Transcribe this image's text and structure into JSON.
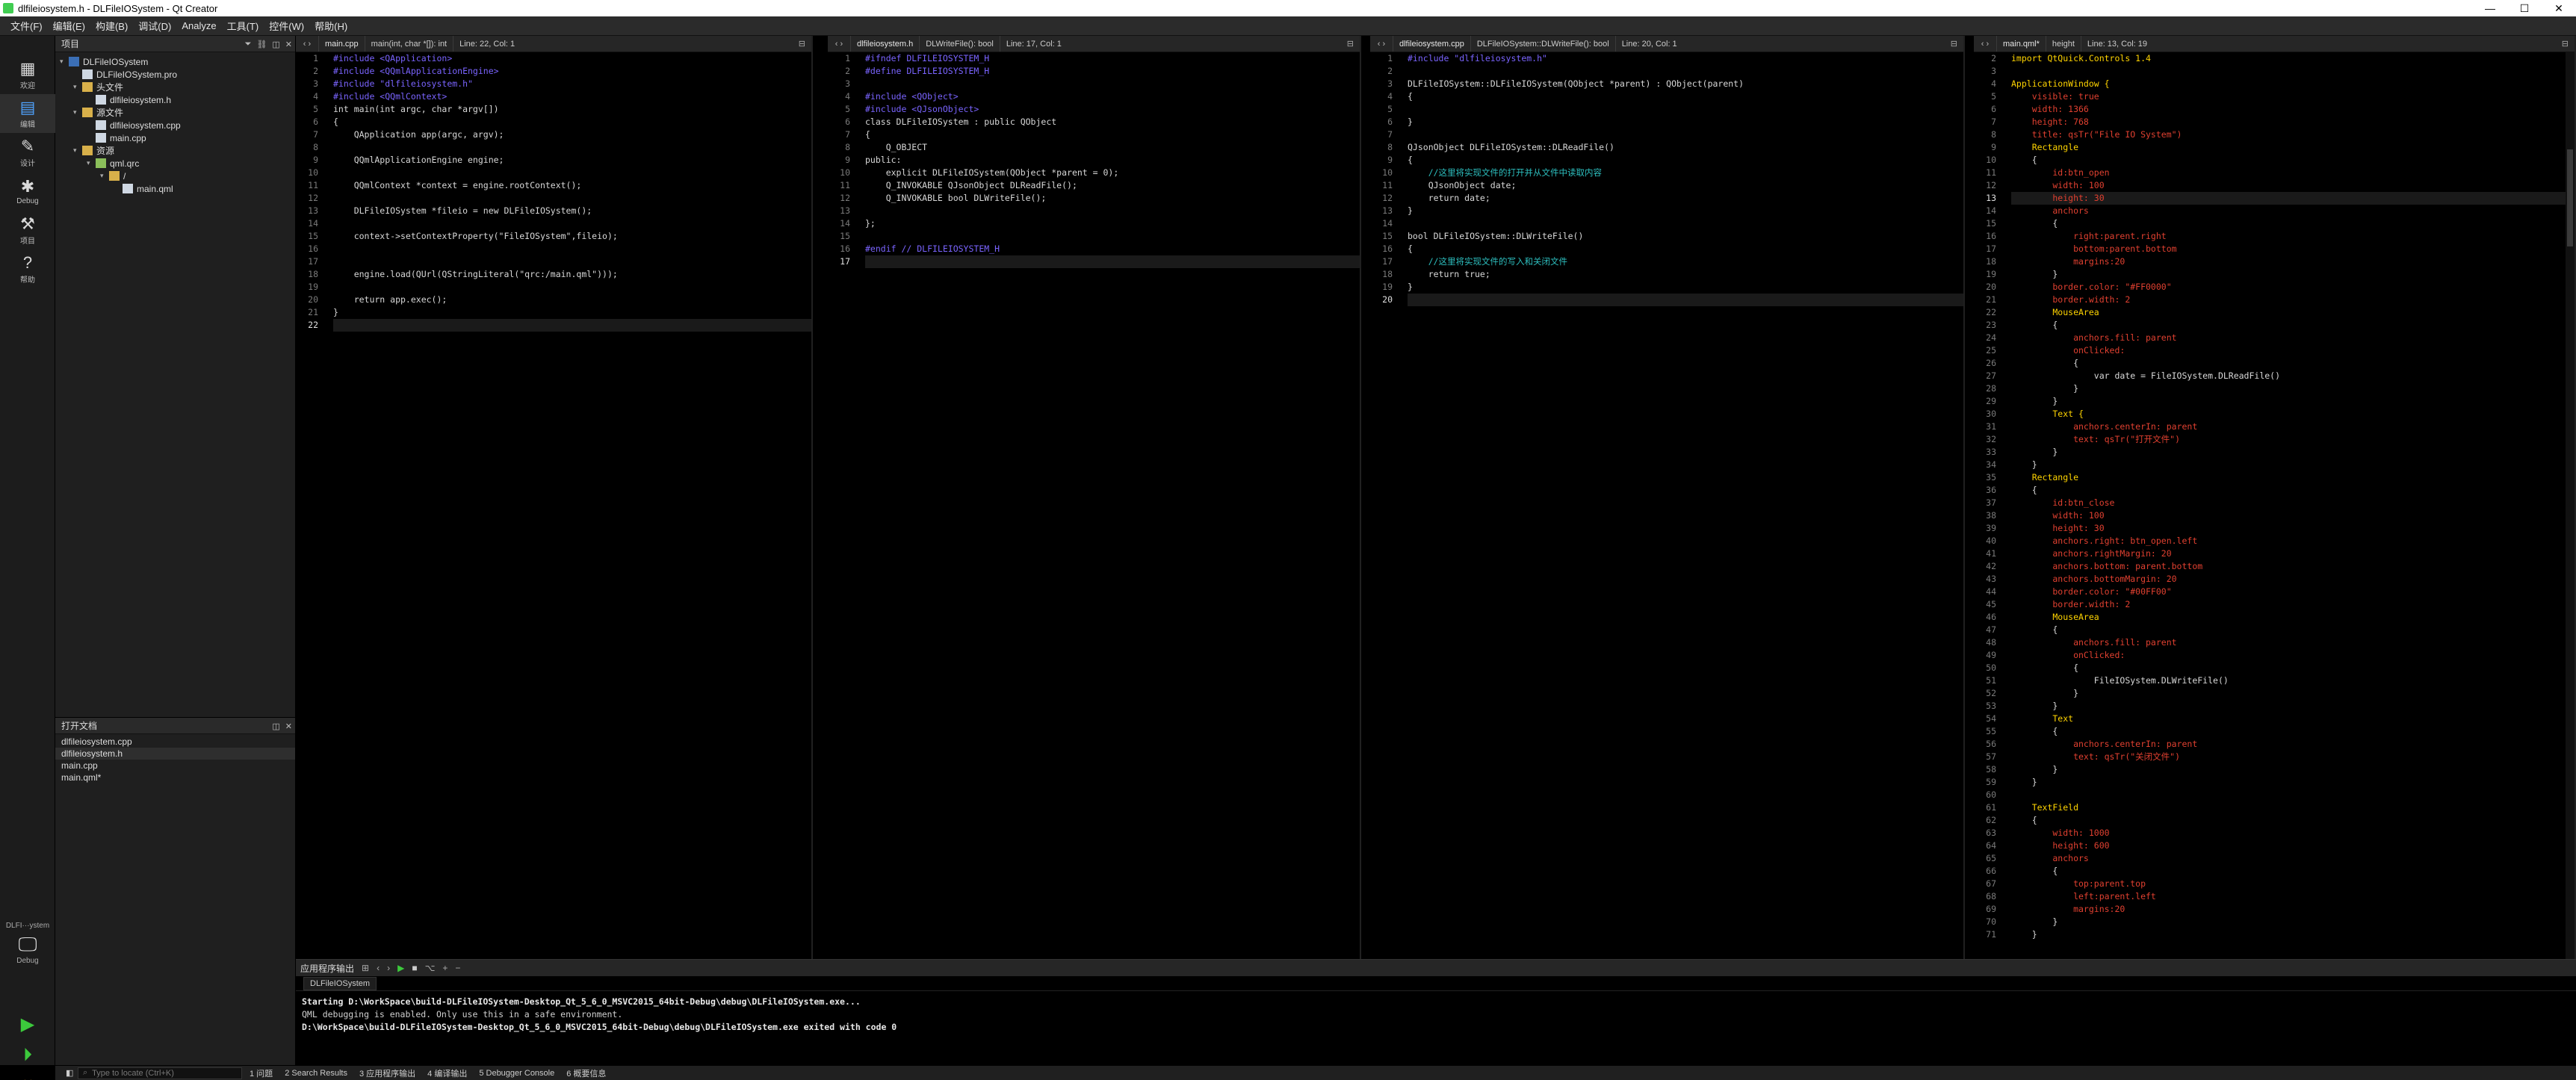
{
  "window": {
    "title": "dlfileiosystem.h - DLFileIOSystem - Qt Creator",
    "min": "—",
    "max": "☐",
    "close": "✕"
  },
  "menu": [
    "文件(F)",
    "编辑(E)",
    "构建(B)",
    "调试(D)",
    "Analyze",
    "工具(T)",
    "控件(W)",
    "帮助(H)"
  ],
  "modes": [
    {
      "label": "欢迎",
      "icon": "grid-icon"
    },
    {
      "label": "编辑",
      "icon": "edit-icon"
    },
    {
      "label": "设计",
      "icon": "pencil-icon"
    },
    {
      "label": "Debug",
      "icon": "bug-icon"
    },
    {
      "label": "项目",
      "icon": "wrench-icon"
    },
    {
      "label": "帮助",
      "icon": "help-icon"
    }
  ],
  "kit": {
    "name": "DLFI···ystem",
    "mode": "Debug"
  },
  "project_panel": {
    "title": "项目",
    "tree": [
      {
        "label": "DLFileIOSystem",
        "depth": 0,
        "icon": "proj",
        "arrow": "▾"
      },
      {
        "label": "DLFileIOSystem.pro",
        "depth": 1,
        "icon": "file",
        "arrow": ""
      },
      {
        "label": "头文件",
        "depth": 1,
        "icon": "folder",
        "arrow": "▾"
      },
      {
        "label": "dlfileiosystem.h",
        "depth": 2,
        "icon": "file",
        "arrow": ""
      },
      {
        "label": "源文件",
        "depth": 1,
        "icon": "folder",
        "arrow": "▾"
      },
      {
        "label": "dlfileiosystem.cpp",
        "depth": 2,
        "icon": "file",
        "arrow": ""
      },
      {
        "label": "main.cpp",
        "depth": 2,
        "icon": "file",
        "arrow": ""
      },
      {
        "label": "资源",
        "depth": 1,
        "icon": "folder",
        "arrow": "▾"
      },
      {
        "label": "qml.qrc",
        "depth": 2,
        "icon": "qrc",
        "arrow": "▾"
      },
      {
        "label": "/",
        "depth": 3,
        "icon": "folder",
        "arrow": "▾"
      },
      {
        "label": "main.qml",
        "depth": 4,
        "icon": "file",
        "arrow": ""
      }
    ]
  },
  "open_docs": {
    "title": "打开文档",
    "items": [
      "dlfileiosystem.cpp",
      "dlfileiosystem.h",
      "main.cpp",
      "main.qml*"
    ]
  },
  "editors": [
    {
      "file": "main.cpp",
      "symbol": "main(int, char *[]): int",
      "pos": "Line: 22, Col: 1",
      "current_line": 22,
      "lines": [
        [
          "pp",
          "#include <QApplication>"
        ],
        [
          "pp",
          "#include <QQmlApplicationEngine>"
        ],
        [
          "pp",
          "#include \"dlfileiosystem.h\""
        ],
        [
          "pp",
          "#include <QQmlContext>"
        ],
        [
          "t",
          "int main(int argc, char *argv[])"
        ],
        [
          "t",
          "{"
        ],
        [
          "t",
          "    QApplication app(argc, argv);"
        ],
        [
          "t",
          ""
        ],
        [
          "t",
          "    QQmlApplicationEngine engine;"
        ],
        [
          "t",
          ""
        ],
        [
          "t",
          "    QQmlContext *context = engine.rootContext();"
        ],
        [
          "t",
          ""
        ],
        [
          "t",
          "    DLFileIOSystem *fileio = new DLFileIOSystem();"
        ],
        [
          "t",
          ""
        ],
        [
          "t",
          "    context->setContextProperty(\"FileIOSystem\",fileio);"
        ],
        [
          "t",
          ""
        ],
        [
          "t",
          ""
        ],
        [
          "t",
          "    engine.load(QUrl(QStringLiteral(\"qrc:/main.qml\")));"
        ],
        [
          "t",
          ""
        ],
        [
          "t",
          "    return app.exec();"
        ],
        [
          "t",
          "}"
        ],
        [
          "t",
          ""
        ]
      ]
    },
    {
      "file": "dlfileiosystem.h",
      "symbol": "DLWriteFile(): bool",
      "pos": "Line: 17, Col: 1",
      "current_line": 17,
      "lines": [
        [
          "pp",
          "#ifndef DLFILEIOSYSTEM_H"
        ],
        [
          "pp",
          "#define DLFILEIOSYSTEM_H"
        ],
        [
          "t",
          ""
        ],
        [
          "pp",
          "#include <QObject>"
        ],
        [
          "pp",
          "#include <QJsonObject>"
        ],
        [
          "t",
          "class DLFileIOSystem : public QObject"
        ],
        [
          "t",
          "{"
        ],
        [
          "t",
          "    Q_OBJECT"
        ],
        [
          "t",
          "public:"
        ],
        [
          "t",
          "    explicit DLFileIOSystem(QObject *parent = 0);"
        ],
        [
          "t",
          "    Q_INVOKABLE QJsonObject DLReadFile();"
        ],
        [
          "t",
          "    Q_INVOKABLE bool DLWriteFile();"
        ],
        [
          "t",
          ""
        ],
        [
          "t",
          "};"
        ],
        [
          "t",
          ""
        ],
        [
          "pp",
          "#endif // DLFILEIOSYSTEM_H"
        ],
        [
          "t",
          ""
        ]
      ]
    },
    {
      "file": "dlfileiosystem.cpp",
      "symbol": "DLFileIOSystem::DLWriteFile(): bool",
      "pos": "Line: 20, Col: 1",
      "current_line": 20,
      "lines": [
        [
          "pp",
          "#include \"dlfileiosystem.h\""
        ],
        [
          "t",
          ""
        ],
        [
          "t",
          "DLFileIOSystem::DLFileIOSystem(QObject *parent) : QObject(parent)"
        ],
        [
          "t",
          "{"
        ],
        [
          "t",
          ""
        ],
        [
          "t",
          "}"
        ],
        [
          "t",
          ""
        ],
        [
          "t",
          "QJsonObject DLFileIOSystem::DLReadFile()"
        ],
        [
          "t",
          "{"
        ],
        [
          "cm",
          "    //这里将实现文件的打开并从文件中读取内容"
        ],
        [
          "t",
          "    QJsonObject date;"
        ],
        [
          "t",
          "    return date;"
        ],
        [
          "t",
          "}"
        ],
        [
          "t",
          ""
        ],
        [
          "t",
          "bool DLFileIOSystem::DLWriteFile()"
        ],
        [
          "t",
          "{"
        ],
        [
          "cm",
          "    //这里将实现文件的写入和关闭文件"
        ],
        [
          "t",
          "    return true;"
        ],
        [
          "t",
          "}"
        ],
        [
          "t",
          ""
        ]
      ]
    },
    {
      "file": "main.qml*",
      "symbol": "height",
      "pos": "Line: 13, Col: 19",
      "current_line": 13,
      "lines": [
        [
          "qkw",
          "import QtQuick.Controls 1.4"
        ],
        [
          "t",
          ""
        ],
        [
          "qkw",
          "ApplicationWindow {"
        ],
        [
          "qprop",
          "    visible: true"
        ],
        [
          "qprop",
          "    width: 1366"
        ],
        [
          "qprop",
          "    height: 768"
        ],
        [
          "qprop",
          "    title: qsTr(\"File IO System\")"
        ],
        [
          "qkw",
          "    Rectangle"
        ],
        [
          "t",
          "    {"
        ],
        [
          "qprop",
          "        id:btn_open"
        ],
        [
          "qprop",
          "        width: 100"
        ],
        [
          "qprop",
          "        height: 30"
        ],
        [
          "qprop",
          "        anchors"
        ],
        [
          "t",
          "        {"
        ],
        [
          "qprop",
          "            right:parent.right"
        ],
        [
          "qprop",
          "            bottom:parent.bottom"
        ],
        [
          "qprop",
          "            margins:20"
        ],
        [
          "t",
          "        }"
        ],
        [
          "qprop",
          "        border.color: \"#FF0000\""
        ],
        [
          "qprop",
          "        border.width: 2"
        ],
        [
          "qkw",
          "        MouseArea"
        ],
        [
          "t",
          "        {"
        ],
        [
          "qprop",
          "            anchors.fill: parent"
        ],
        [
          "qprop",
          "            onClicked:"
        ],
        [
          "t",
          "            {"
        ],
        [
          "t",
          "                var date = FileIOSystem.DLReadFile()"
        ],
        [
          "t",
          "            }"
        ],
        [
          "t",
          "        }"
        ],
        [
          "qkw",
          "        Text {"
        ],
        [
          "qprop",
          "            anchors.centerIn: parent"
        ],
        [
          "qprop",
          "            text: qsTr(\"打开文件\")"
        ],
        [
          "t",
          "        }"
        ],
        [
          "t",
          "    }"
        ],
        [
          "qkw",
          "    Rectangle"
        ],
        [
          "t",
          "    {"
        ],
        [
          "qprop",
          "        id:btn_close"
        ],
        [
          "qprop",
          "        width: 100"
        ],
        [
          "qprop",
          "        height: 30"
        ],
        [
          "qprop",
          "        anchors.right: btn_open.left"
        ],
        [
          "qprop",
          "        anchors.rightMargin: 20"
        ],
        [
          "qprop",
          "        anchors.bottom: parent.bottom"
        ],
        [
          "qprop",
          "        anchors.bottomMargin: 20"
        ],
        [
          "qprop",
          "        border.color: \"#00FF00\""
        ],
        [
          "qprop",
          "        border.width: 2"
        ],
        [
          "qkw",
          "        MouseArea"
        ],
        [
          "t",
          "        {"
        ],
        [
          "qprop",
          "            anchors.fill: parent"
        ],
        [
          "qprop",
          "            onClicked:"
        ],
        [
          "t",
          "            {"
        ],
        [
          "t",
          "                FileIOSystem.DLWriteFile()"
        ],
        [
          "t",
          "            }"
        ],
        [
          "t",
          "        }"
        ],
        [
          "qkw",
          "        Text"
        ],
        [
          "t",
          "        {"
        ],
        [
          "qprop",
          "            anchors.centerIn: parent"
        ],
        [
          "qprop",
          "            text: qsTr(\"关闭文件\")"
        ],
        [
          "t",
          "        }"
        ],
        [
          "t",
          "    }"
        ],
        [
          "t",
          ""
        ],
        [
          "qkw",
          "    TextField"
        ],
        [
          "t",
          "    {"
        ],
        [
          "qprop",
          "        width: 1000"
        ],
        [
          "qprop",
          "        height: 600"
        ],
        [
          "qprop",
          "        anchors"
        ],
        [
          "t",
          "        {"
        ],
        [
          "qprop",
          "            top:parent.top"
        ],
        [
          "qprop",
          "            left:parent.left"
        ],
        [
          "qprop",
          "            margins:20"
        ],
        [
          "t",
          "        }"
        ],
        [
          "t",
          "    }"
        ]
      ],
      "first_line_number": 2
    }
  ],
  "output": {
    "title": "应用程序输出",
    "tab": "DLFileIOSystem",
    "lines": [
      {
        "text": "Starting D:\\WorkSpace\\build-DLFileIOSystem-Desktop_Qt_5_6_0_MSVC2015_64bit-Debug\\debug\\DLFileIOSystem.exe...",
        "bold": true
      },
      {
        "text": "QML debugging is enabled. Only use this in a safe environment.",
        "bold": false
      },
      {
        "text": "D:\\WorkSpace\\build-DLFileIOSystem-Desktop_Qt_5_6_0_MSVC2015_64bit-Debug\\debug\\DLFileIOSystem.exe exited with code 0",
        "bold": true
      }
    ]
  },
  "statusbar": {
    "locate_placeholder": "Type to locate (Ctrl+K)",
    "panes": [
      "1 问题",
      "2 Search Results",
      "3 应用程序输出",
      "4 编译输出",
      "5 Debugger Console",
      "6 概要信息"
    ]
  }
}
